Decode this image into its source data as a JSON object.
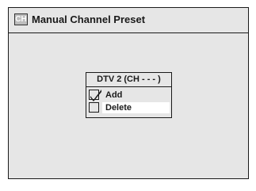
{
  "window": {
    "icon_text": "CH",
    "title": "Manual Channel Preset"
  },
  "popup": {
    "header": "DTV  2  (CH - - - )",
    "options": [
      {
        "label": "Add",
        "checked": true,
        "highlighted": false
      },
      {
        "label": "Delete",
        "checked": false,
        "highlighted": true
      }
    ]
  },
  "colors": {
    "panel_bg": "#e6e6e6",
    "border": "#1a1a1a",
    "highlight": "#ffffff",
    "icon_bg": "#bdbdbd"
  }
}
